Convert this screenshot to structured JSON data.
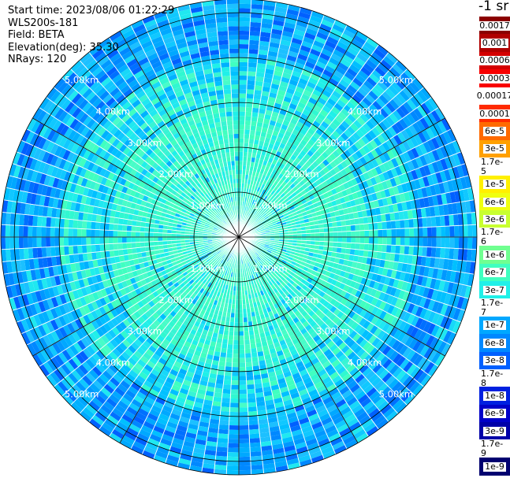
{
  "header": {
    "start_time": "Start time: 2023/08/06 01:22:29",
    "instrument": "WLS200s-181",
    "field": "Field: BETA",
    "elevation": "Elevation(deg): 35.30",
    "nrays": "NRays: 120"
  },
  "plot": {
    "max_range_km": 5.3,
    "ring_labels": [
      "1.00km",
      "2.00km",
      "3.00km",
      "4.00km",
      "5.00km"
    ],
    "ray_count": 120,
    "range_gates": 53
  },
  "colorbar": {
    "unit": "-1 sr",
    "labels": [
      "0.0017",
      "0.001",
      "0.0006",
      "0.0003",
      "0.00017",
      "0.0001",
      "6e-5",
      "3e-5",
      "1.7e-5",
      "1e-5",
      "6e-6",
      "3e-6",
      "1.7e-6",
      "1e-6",
      "6e-7",
      "3e-7",
      "1.7e-7",
      "1e-7",
      "6e-8",
      "3e-8",
      "1.7e-8",
      "1e-8",
      "6e-9",
      "3e-9",
      "1.7e-9",
      "1e-9"
    ],
    "colors": [
      "#8b0000",
      "#b00000",
      "#d40000",
      "#f80000",
      "#ffffff",
      "#ff2a00",
      "#ff6a00",
      "#ffa000",
      "#ffd000",
      "#fff000",
      "#f0ff10",
      "#c8ff30",
      "#a0ff60",
      "#70ff90",
      "#40ffc0",
      "#20f0e8",
      "#10c8ff",
      "#00a8ff",
      "#0088ff",
      "#0060ff",
      "#0040f0",
      "#0020e0",
      "#0000c8",
      "#0000a8",
      "#000090",
      "#000070"
    ]
  }
}
